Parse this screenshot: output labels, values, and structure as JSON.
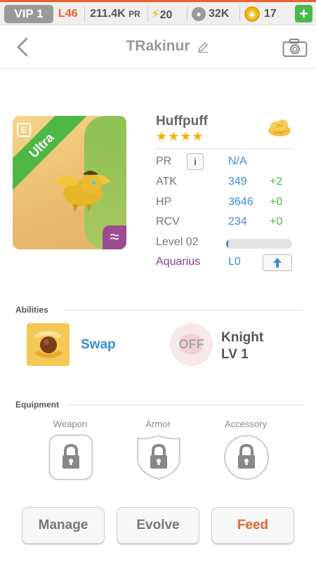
{
  "topbar": {
    "vip": "VIP 1",
    "level": "L46",
    "pr_value": "211.4K",
    "pr_suffix": "PR",
    "energy": "20",
    "food": "32K",
    "coins": "17",
    "plus": "+",
    "accent_color": "#e8632c"
  },
  "header": {
    "title": "TRakinur",
    "back_icon": "chevron-left-icon",
    "edit_icon": "pencil-icon",
    "camera_icon": "camera-icon"
  },
  "pet": {
    "rarity": "Ultra",
    "card_badge": "E",
    "element_glyph": "≈",
    "name": "Huffpuff",
    "stars": "★★★★",
    "star_count": 4,
    "element_icon": "cloud-icon",
    "stats": {
      "pr_label": "PR",
      "info_btn": "i",
      "pr_value": "N/A",
      "atk_label": "ATK",
      "atk_value": "349",
      "atk_bonus": "+2",
      "hp_label": "HP",
      "hp_value": "3646",
      "hp_bonus": "+0",
      "rcv_label": "RCV",
      "rcv_value": "234",
      "rcv_bonus": "+0",
      "level_label": "Level 02",
      "level_progress": 0.03,
      "sign_label": "Aquarius",
      "sign_value": "L0",
      "upgrade_icon": "arrow-up-icon"
    }
  },
  "abilities": {
    "section_label": "Abilities",
    "skill_name": "Swap",
    "sub_status": "OFF",
    "sub_name": "Knight",
    "sub_level": "LV 1"
  },
  "equipment": {
    "section_label": "Equipment",
    "slots": [
      {
        "label": "Weapon",
        "icon": "lock-icon"
      },
      {
        "label": "Armor",
        "icon": "lock-icon"
      },
      {
        "label": "Accessory",
        "icon": "lock-icon"
      }
    ]
  },
  "actions": {
    "manage": "Manage",
    "evolve": "Evolve",
    "feed": "Feed"
  }
}
